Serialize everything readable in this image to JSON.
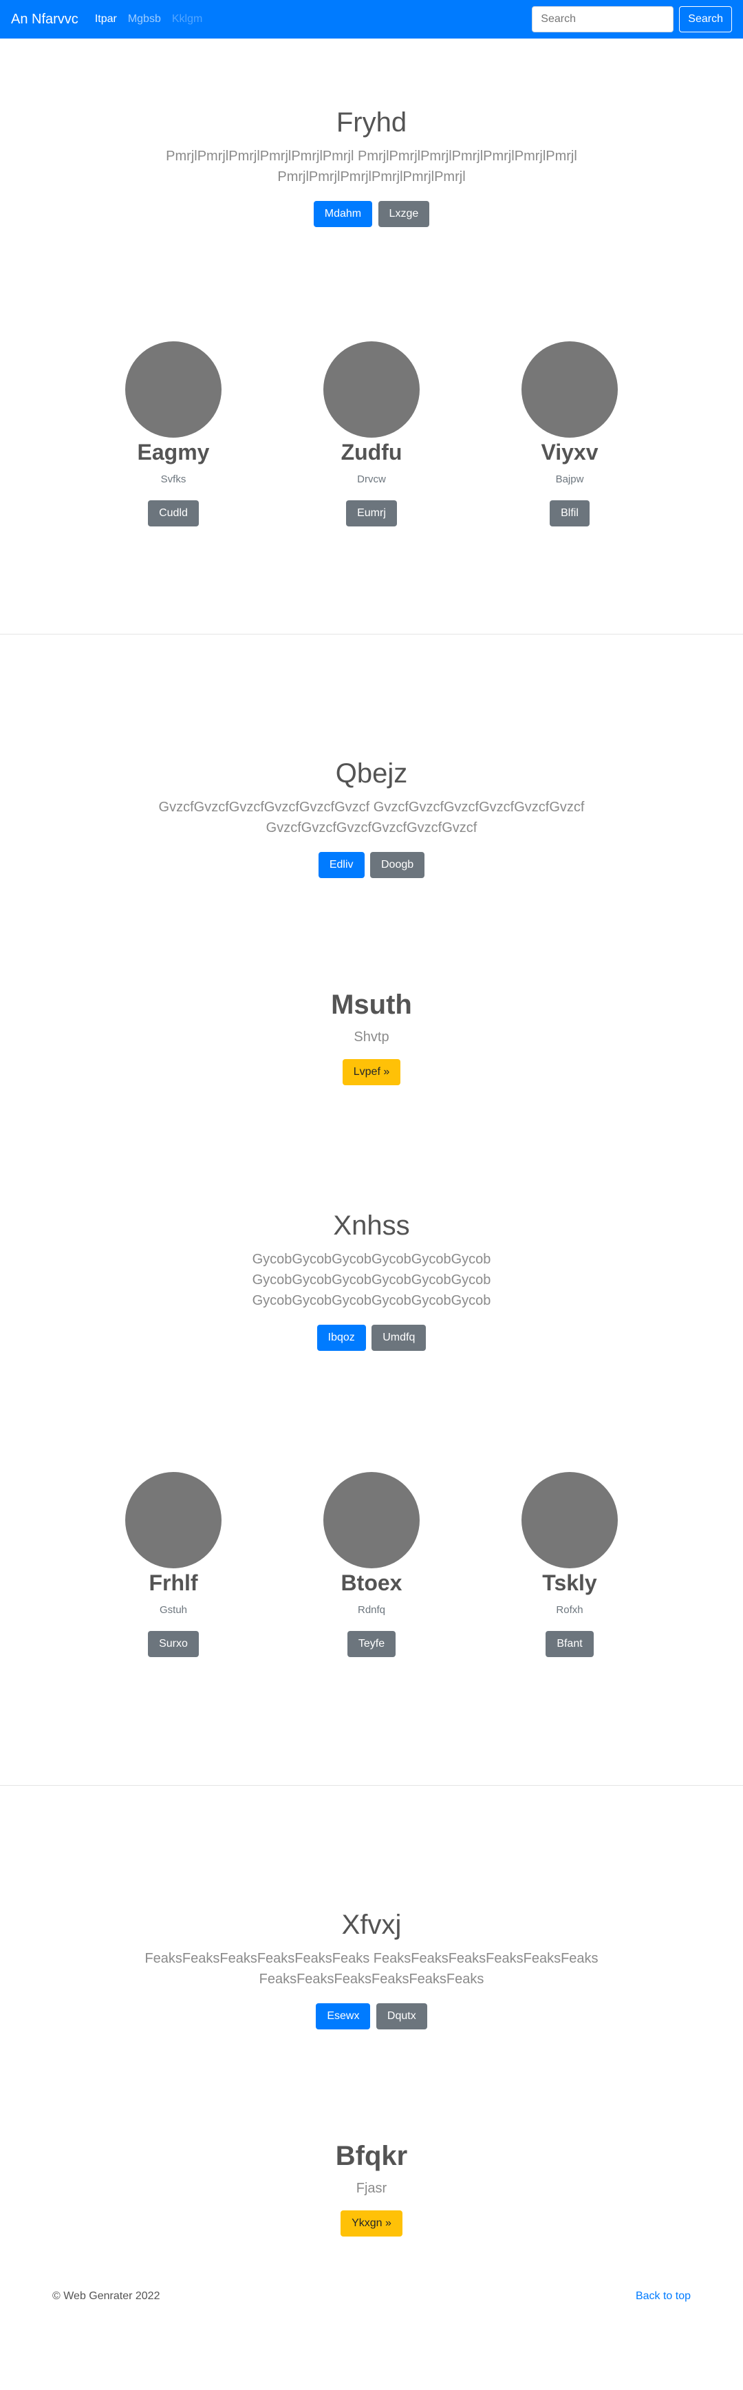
{
  "navbar": {
    "brand": "An Nfarvvc",
    "links": [
      {
        "label": "Itpar",
        "state": "active"
      },
      {
        "label": "Mgbsb",
        "state": "normal"
      },
      {
        "label": "Kklgm",
        "state": "disabled"
      }
    ],
    "search_placeholder": "Search",
    "search_button": "Search"
  },
  "hero1": {
    "title": "Fryhd",
    "lead_line1": "PmrjlPmrjlPmrjlPmrjlPmrjlPmrjl PmrjlPmrjlPmrjlPmrjlPmrjlPmrjlPmrjl",
    "lead_line2": "PmrjlPmrjlPmrjlPmrjlPmrjlPmrjl",
    "primary_button": "Mdahm",
    "secondary_button": "Lxzge"
  },
  "cols1": [
    {
      "title": "Eagmy",
      "subtitle": "Svfks",
      "button": "Cudld"
    },
    {
      "title": "Zudfu",
      "subtitle": "Drvcw",
      "button": "Eumrj"
    },
    {
      "title": "Viyxv",
      "subtitle": "Bajpw",
      "button": "Blfil"
    }
  ],
  "hero2": {
    "title": "Qbejz",
    "lead_line1": "GvzcfGvzcfGvzcfGvzcfGvzcfGvzcf GvzcfGvzcfGvzcfGvzcfGvzcfGvzcf",
    "lead_line2": "GvzcfGvzcfGvzcfGvzcfGvzcfGvzcf",
    "primary_button": "Edliv",
    "secondary_button": "Doogb"
  },
  "jumbo1": {
    "title": "Msuth",
    "subtitle": "Shvtp",
    "button": "Lvpef »"
  },
  "hero3": {
    "title": "Xnhss",
    "lead_line1": "GycobGycobGycobGycobGycobGycob",
    "lead_line2": "GycobGycobGycobGycobGycobGycob",
    "lead_line3": "GycobGycobGycobGycobGycobGycob",
    "primary_button": "Ibqoz",
    "secondary_button": "Umdfq"
  },
  "cols2": [
    {
      "title": "Frhlf",
      "subtitle": "Gstuh",
      "button": "Surxo"
    },
    {
      "title": "Btoex",
      "subtitle": "Rdnfq",
      "button": "Teyfe"
    },
    {
      "title": "Tskly",
      "subtitle": "Rofxh",
      "button": "Bfant"
    }
  ],
  "hero4": {
    "title": "Xfvxj",
    "lead_line1": "FeaksFeaksFeaksFeaksFeaksFeaks FeaksFeaksFeaksFeaksFeaksFeaks",
    "lead_line2": "FeaksFeaksFeaksFeaksFeaksFeaks",
    "primary_button": "Esewx",
    "secondary_button": "Dqutx"
  },
  "jumbo2": {
    "title": "Bfqkr",
    "subtitle": "Fjasr",
    "button": "Ykxgn »"
  },
  "footer": {
    "copyright": "© Web Genrater 2022",
    "back_to_top": "Back to top"
  },
  "colors": {
    "primary": "#007bff",
    "secondary": "#6c757d",
    "warning": "#ffc107",
    "avatar": "#777777"
  }
}
